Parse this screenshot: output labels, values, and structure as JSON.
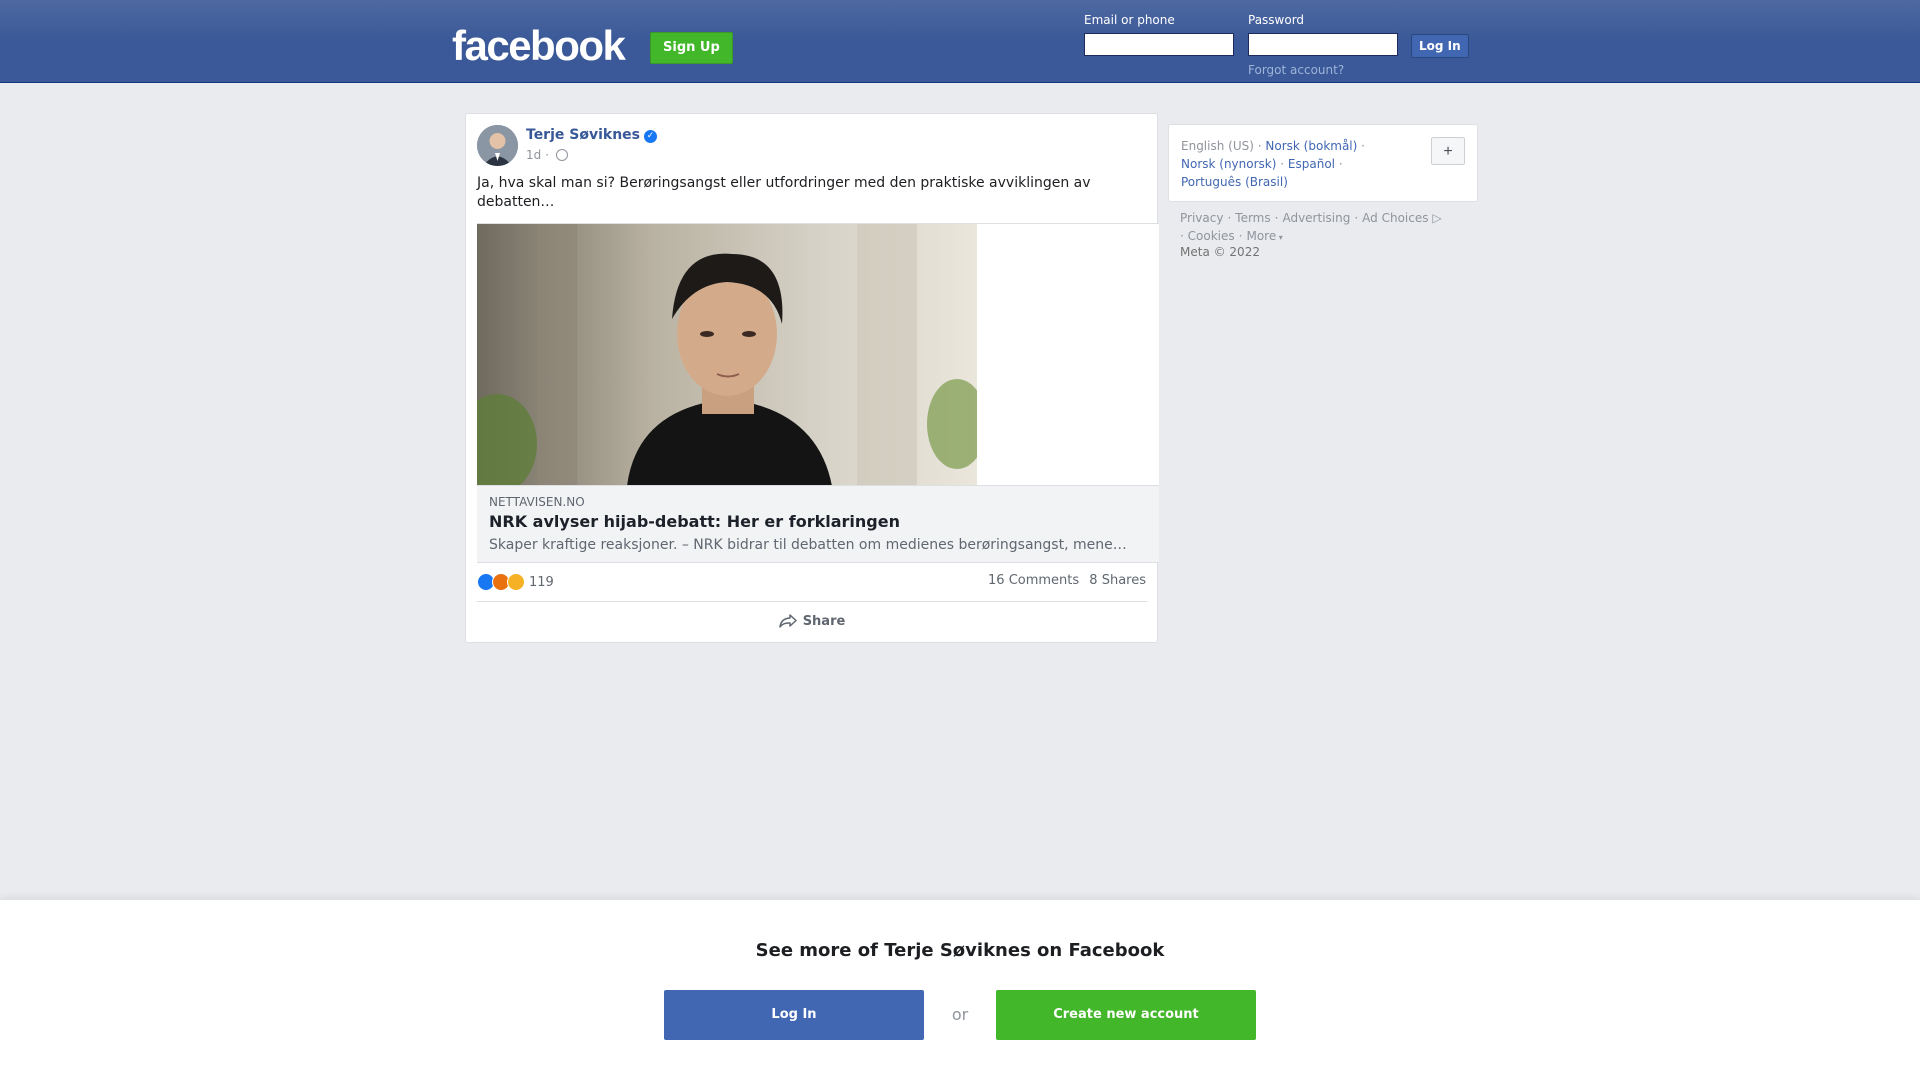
{
  "header": {
    "logo": "facebook",
    "signup_label": "Sign Up",
    "email_label": "Email or phone",
    "email_value": "",
    "password_label": "Password",
    "password_value": "",
    "login_label": "Log In",
    "forgot_label": "Forgot account?"
  },
  "post": {
    "author": "Terje Søviknes",
    "verified_icon": "check-icon",
    "time": "1d",
    "separator": "·",
    "audience_icon": "globe-icon",
    "text": "Ja, hva skal man si? Berøringsangst eller utfordringer med den praktiske avviklingen av debatten…",
    "link": {
      "domain": "NETTAVISEN.NO",
      "title": "NRK avlyser hijab-debatt: Her er forklaringen",
      "description": "Skaper kraftige reaksjoner. – NRK bidrar til debatten om medienes berøringsangst, mener…"
    },
    "reaction_icons": [
      "like-icon",
      "angry-icon",
      "sad-icon"
    ],
    "reaction_count": "119",
    "comments": "16 Comments",
    "shares": "8 Shares",
    "share_label": "Share"
  },
  "languages": {
    "current": "English (US)",
    "items": [
      "Norsk (bokmål)",
      "Norsk (nynorsk)",
      "Español",
      "Português (Brasil)"
    ],
    "separator": "·",
    "plus_label": "+"
  },
  "footer": {
    "links": [
      "Privacy",
      "Terms",
      "Advertising",
      "Ad Choices",
      "Cookies",
      "More"
    ],
    "separator": "·",
    "copyright": "Meta © 2022"
  },
  "bottom_bar": {
    "title": "See more of Terje Søviknes on Facebook",
    "login_label": "Log In",
    "or_label": "or",
    "create_label": "Create new account"
  },
  "colors": {
    "brand_blue": "#3b5998",
    "button_blue": "#4267b2",
    "green": "#42b72a",
    "link": "#385898"
  }
}
